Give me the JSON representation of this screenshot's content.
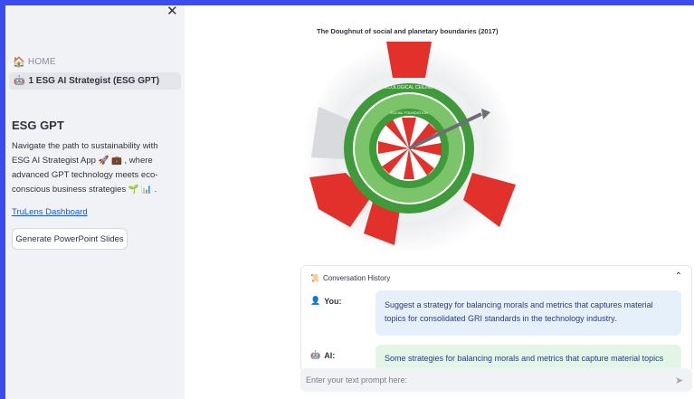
{
  "sidebar": {
    "close_glyph": "✕",
    "home_label": "HOME",
    "page_label": "1 ESG AI Strategist (ESG GPT)",
    "title": "ESG GPT",
    "description": "Navigate the path to sustainability with ESG AI Strategist App 🚀 💼 , where advanced GPT technology meets eco-conscious business strategies 🌱 📊 .",
    "link_label": "TruLens Dashboard",
    "button_label": "Generate PowerPoint Slides"
  },
  "figure": {
    "title": "The Doughnut of social and planetary boundaries (2017)",
    "ceiling_label": "ECOLOGICAL CEILING",
    "foundation_label": "SOCIAL FOUNDATION",
    "outer_labels": [
      "climate change",
      "ozone layer depletion",
      "air pollution",
      "chemical pollution",
      "nitrogen & phosphorus loading",
      "freshwater withdrawals",
      "land conversion",
      "biodiversity loss"
    ],
    "inner_labels": [
      "water",
      "food",
      "health",
      "education",
      "income & work",
      "peace & justice",
      "political voice",
      "social equity",
      "gender equality",
      "housing",
      "networks",
      "energy"
    ]
  },
  "conversation": {
    "header": "Conversation History",
    "user_label": "You:",
    "user_message": "Suggest a strategy for balancing morals and metrics that captures material topics for consolidated GRI standards in the technology industry.",
    "ai_label": "AI:",
    "ai_message": "Some strategies for balancing morals and metrics that capture material topics"
  },
  "input": {
    "placeholder": "Enter your text prompt here:"
  },
  "colors": {
    "sidebar_bg": "#f0f2f6",
    "accent_blue": "#3a4cf0",
    "doughnut_green": "#3f9a3c",
    "overshoot_red": "#e2302b",
    "user_bubble": "#e6f0fb",
    "ai_bubble": "#e3f5e6"
  }
}
